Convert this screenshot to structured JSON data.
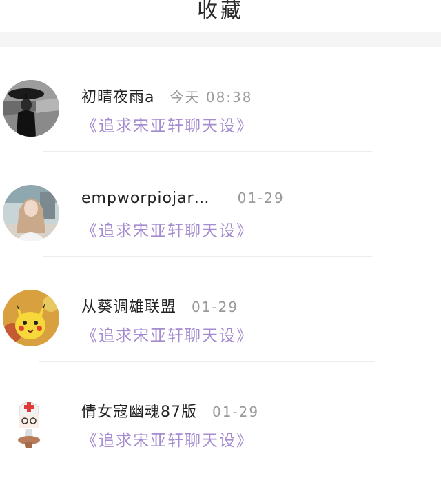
{
  "header": {
    "title": "收藏"
  },
  "items": [
    {
      "name": "初晴夜雨a",
      "time": "今天 08:38",
      "message": "《追求宋亚轩聊天设》",
      "avatar": "avatar-girl-umbrella-bw"
    },
    {
      "name": "empworpiojar…",
      "time": "01-29",
      "message": "《追求宋亚轩聊天设》",
      "avatar": "avatar-girl-photo"
    },
    {
      "name": "从葵调雄联盟",
      "time": "01-29",
      "message": "《追求宋亚轩聊天设》",
      "avatar": "avatar-pikachu"
    },
    {
      "name": "倩女寇幽魂87版",
      "time": "01-29",
      "message": "《追求宋亚轩聊天设》",
      "avatar": "avatar-nurse-character"
    }
  ]
}
